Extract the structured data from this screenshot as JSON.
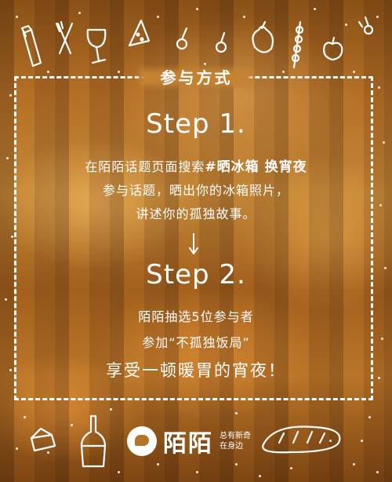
{
  "section_title": "参与方式",
  "step1": {
    "title": "Step 1.",
    "line1_prefix": "在陌陌话题页面搜索",
    "line1_hashtag": "#晒冰箱 换宵夜",
    "line2": "参与话题，晒出你的冰箱照片，",
    "line3": "讲述你的孤独故事。"
  },
  "step2": {
    "title": "Step 2.",
    "line1": "陌陌抽选5位参与者",
    "line2": "参加“不孤独饭局”",
    "line3": "享受一顿暖胃的宵夜！"
  },
  "brand": {
    "name": "陌陌",
    "tagline_line1": "总有新奇",
    "tagline_line2": "在身边"
  },
  "colors": {
    "text": "#ffffff",
    "background_warm": "#b57328",
    "background_dark": "#7e4713"
  }
}
